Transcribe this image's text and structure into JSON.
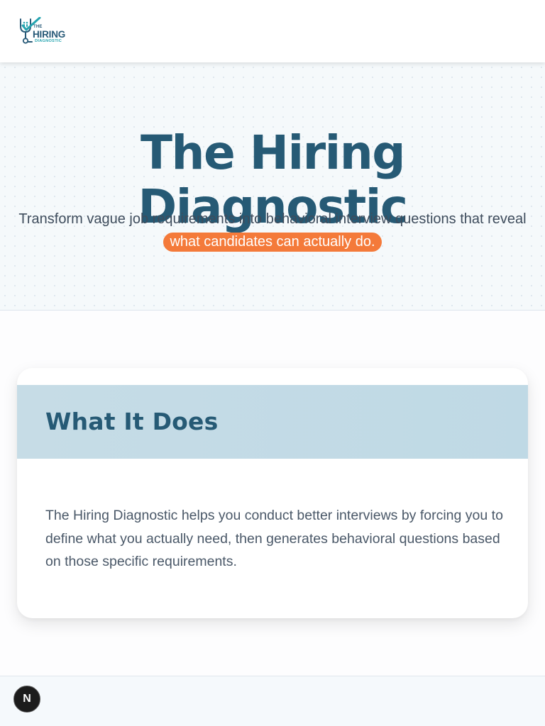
{
  "header": {
    "logo": {
      "icon": "stethoscope-checkmark-icon",
      "the": "THE",
      "hiring": "HIRING",
      "diagnostic": "DIAGNOSTIC"
    }
  },
  "hero": {
    "title": "The Hiring Diagnostic",
    "subtitle": "Transform vague job requirements into behavioral interview questions that reveal",
    "highlight": "what candidates can actually do."
  },
  "card": {
    "title": "What It Does",
    "body": "The Hiring Diagnostic helps you conduct better interviews by forcing you to define what you actually need, then generates behavioral questions based on those specific requirements."
  },
  "badge": {
    "letter": "N"
  },
  "colors": {
    "brand_dark": "#265a75",
    "brand_teal": "#26a4b0",
    "accent_orange": "#f47a3a",
    "card_header_bg": "#c3dbe6"
  }
}
